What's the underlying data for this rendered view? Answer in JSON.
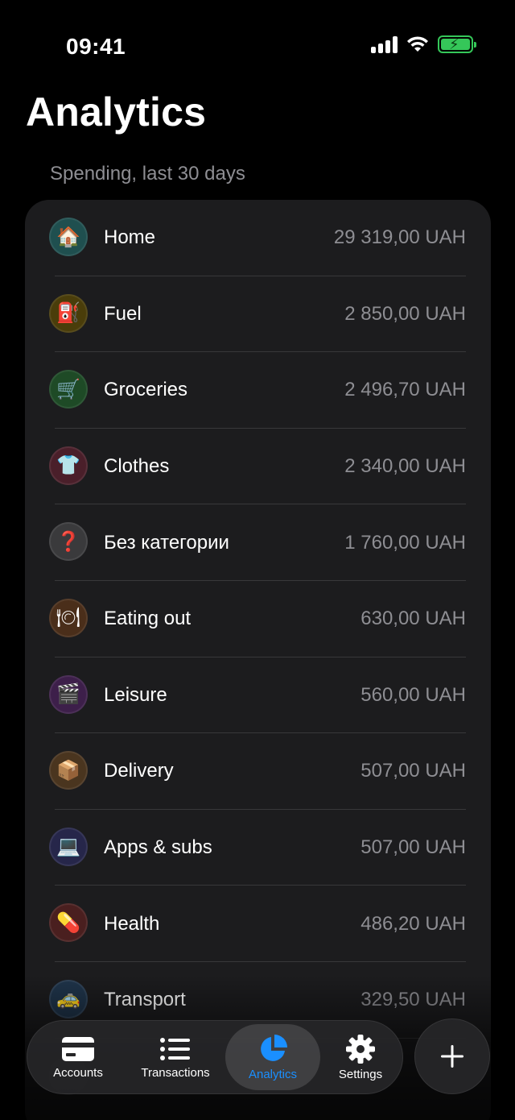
{
  "status_bar": {
    "time": "09:41"
  },
  "header": {
    "title": "Analytics",
    "subtitle": "Spending, last 30 days"
  },
  "categories": [
    {
      "name": "Home",
      "amount": "29 319,00 UAH",
      "icon": "house-icon",
      "emoji": "🏠",
      "color": "#1f4f4f"
    },
    {
      "name": "Fuel",
      "amount": "2 850,00 UAH",
      "icon": "fuel-icon",
      "emoji": "⛽",
      "color": "#4a3d0a"
    },
    {
      "name": "Groceries",
      "amount": "2 496,70 UAH",
      "icon": "cart-icon",
      "emoji": "🛒",
      "color": "#1e4a26"
    },
    {
      "name": "Clothes",
      "amount": "2 340,00 UAH",
      "icon": "shirt-icon",
      "emoji": "👕",
      "color": "#4a1f2a"
    },
    {
      "name": "Без категории",
      "amount": "1 760,00 UAH",
      "icon": "question-icon",
      "emoji": "❓",
      "color": "#3a3a3c"
    },
    {
      "name": "Eating out",
      "amount": "630,00 UAH",
      "icon": "plate-icon",
      "emoji": "🍽",
      "color": "#4a2e1a"
    },
    {
      "name": "Leisure",
      "amount": "560,00 UAH",
      "icon": "clapper-icon",
      "emoji": "🎬",
      "color": "#3d1f4a"
    },
    {
      "name": "Delivery",
      "amount": "507,00 UAH",
      "icon": "package-icon",
      "emoji": "📦",
      "color": "#4a351f"
    },
    {
      "name": "Apps & subs",
      "amount": "507,00 UAH",
      "icon": "laptop-icon",
      "emoji": "💻",
      "color": "#26264a"
    },
    {
      "name": "Health",
      "amount": "486,20 UAH",
      "icon": "pill-icon",
      "emoji": "💊",
      "color": "#4a1f1f"
    },
    {
      "name": "Transport",
      "amount": "329,50 UAH",
      "icon": "taxi-icon",
      "emoji": "🚕",
      "color": "#1f344a"
    },
    {
      "name": "",
      "amount": "",
      "icon": "",
      "emoji": "",
      "color": "#2a2a2c"
    }
  ],
  "tab_bar": {
    "accounts": "Accounts",
    "transactions": "Transactions",
    "analytics": "Analytics",
    "settings": "Settings",
    "active": "analytics",
    "active_color": "#1a8fff"
  }
}
